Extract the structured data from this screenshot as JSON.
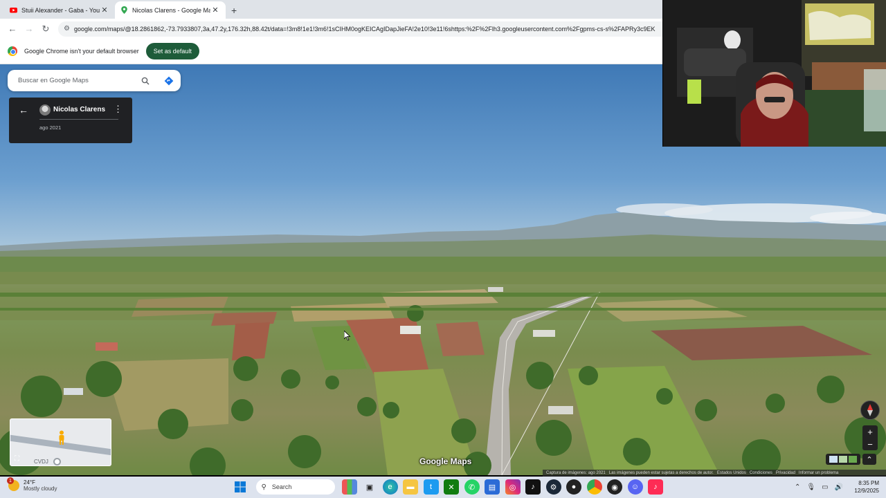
{
  "browser": {
    "tabs": [
      {
        "title": "Stuii Alexander - Gaba - YouTube",
        "close": "✕",
        "active": false,
        "favicon": "youtube-icon"
      },
      {
        "title": "Nicolas Clarens - Google Maps",
        "close": "✕",
        "active": true,
        "favicon": "maps-pin-icon"
      }
    ],
    "new_tab": "+",
    "url": "google.com/maps/@18.2861862,-73.7933807,3a,47.2y,176.32h,88.42t/data=!3m8!1e1!3m6!1sCIHM0ogKEICAgIDapJieFA!2e10!3e11!6shttps:%2F%2Flh3.googleusercontent.com%2Fgpms-cs-s%2FAPRy3c9EK",
    "infobar_text": "Google Chrome isn't your default browser",
    "infobar_button": "Set as default"
  },
  "maps": {
    "search_placeholder": "Buscar en Google Maps",
    "place_name": "Nicolas Clarens",
    "place_date": "ago 2021",
    "minimap_label": "CVDJ",
    "logo": "Google Maps",
    "footer": [
      "Captura de imágenes: ago 2021",
      "Las imágenes pueden estar sujetas a derechos de autor.",
      "Estados Unidos",
      "Condiciones",
      "Privacidad",
      "Informar un problema"
    ]
  },
  "taskbar": {
    "weather_temp": "24°F",
    "weather_desc": "Mostly cloudy",
    "weather_badge": "1",
    "search": "Search",
    "time": "8:35 PM",
    "date": "12/9/2025"
  },
  "colors": {
    "infobar_button": "#1e5c3a",
    "place_card": "#202124",
    "taskbar": "#dde3ee"
  }
}
